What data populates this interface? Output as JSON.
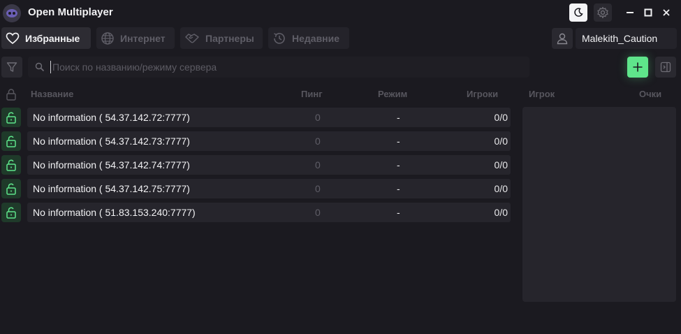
{
  "app": {
    "title": "Open Multiplayer"
  },
  "tabs": [
    {
      "label": "Избранные"
    },
    {
      "label": "Интернет"
    },
    {
      "label": "Партнеры"
    },
    {
      "label": "Недавние"
    }
  ],
  "user": {
    "name": "Malekith_Caution"
  },
  "search": {
    "placeholder": "Поиск по названию/режиму сервера"
  },
  "table": {
    "headers": {
      "name": "Название",
      "ping": "Пинг",
      "mode": "Режим",
      "players": "Игроки"
    },
    "rows": [
      {
        "name": "No information ( 54.37.142.72:7777)",
        "ping": "0",
        "mode": "-",
        "players": "0/0"
      },
      {
        "name": "No information ( 54.37.142.73:7777)",
        "ping": "0",
        "mode": "-",
        "players": "0/0"
      },
      {
        "name": "No information ( 54.37.142.74:7777)",
        "ping": "0",
        "mode": "-",
        "players": "0/0"
      },
      {
        "name": "No information ( 54.37.142.75:7777)",
        "ping": "0",
        "mode": "-",
        "players": "0/0"
      },
      {
        "name": "No information ( 51.83.153.240:7777)",
        "ping": "0",
        "mode": "-",
        "players": "0/0"
      }
    ]
  },
  "player_panel": {
    "headers": {
      "player": "Игрок",
      "score": "Очки"
    }
  },
  "colors": {
    "accent": "#5fe58b",
    "background": "#1b1a20",
    "row": "#26252c"
  }
}
